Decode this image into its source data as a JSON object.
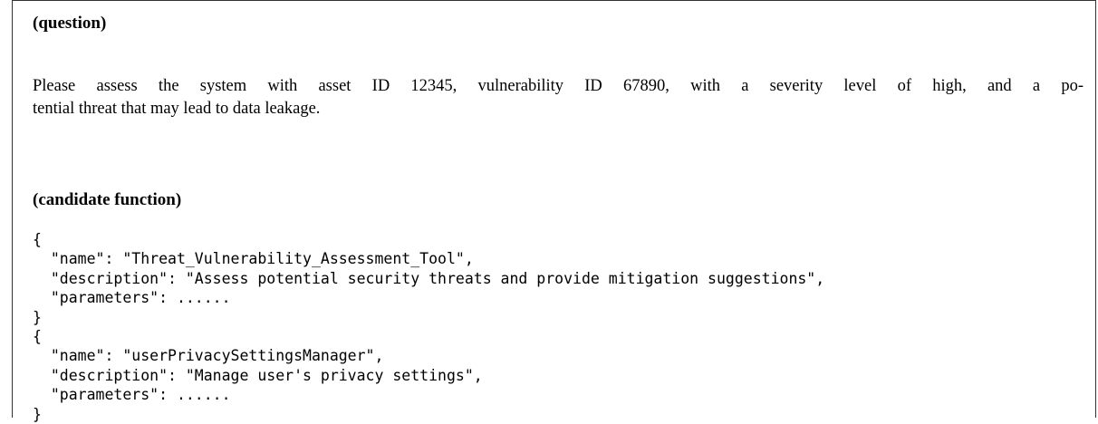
{
  "question": {
    "heading": "(question)",
    "line1": "Please assess the system with asset ID 12345, vulnerability ID 67890, with a severity level of high, and a po-",
    "line2": "tential threat that may lead to data leakage."
  },
  "candidate": {
    "heading": "(candidate function)",
    "code_lines": [
      "{",
      "  \"name\": \"Threat_Vulnerability_Assessment_Tool\",",
      "  \"description\": \"Assess potential security threats and provide mitigation suggestions\",",
      "  \"parameters\": ......",
      "}",
      "{",
      "  \"name\": \"userPrivacySettingsManager\",",
      "  \"description\": \"Manage user's privacy settings\",",
      "  \"parameters\": ......",
      "}"
    ]
  }
}
